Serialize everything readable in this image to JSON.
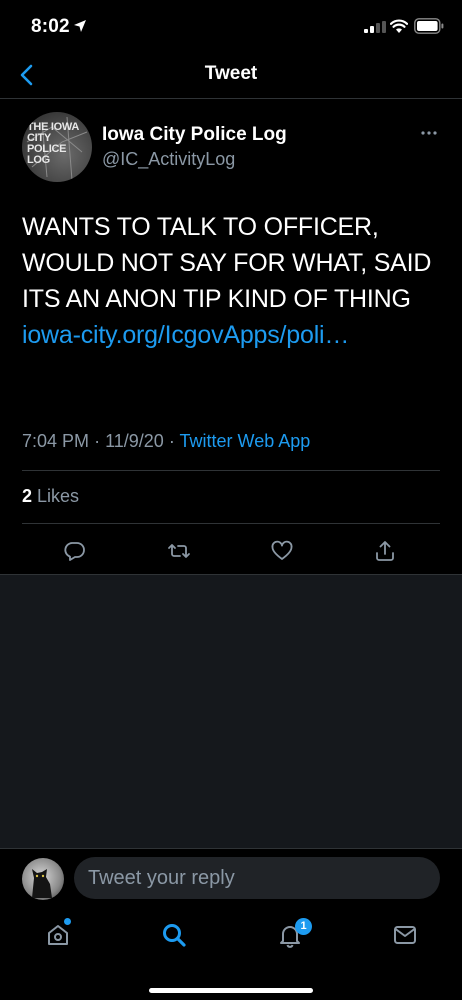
{
  "status_bar": {
    "time": "8:02"
  },
  "nav": {
    "title": "Tweet"
  },
  "tweet": {
    "avatar_text": "THE IOWA CITY POLICE LOG",
    "author_name": "Iowa City Police Log",
    "author_handle": "@IC_ActivityLog",
    "body": "WANTS TO TALK TO OFFICER, WOULD NOT SAY FOR WHAT, SAID ITS AN ANON TIP KIND OF THING",
    "link": "iowa-city.org/IcgovApps/poli…",
    "time": "7:04 PM",
    "date": "11/9/20",
    "separator": "·",
    "source": "Twitter Web App",
    "likes_count": "2",
    "likes_label": "Likes"
  },
  "reply": {
    "placeholder": "Tweet your reply"
  },
  "tabs": {
    "notifications_badge": "1"
  },
  "colors": {
    "accent": "#1d9bf0",
    "muted": "#8b98a5",
    "background": "#000000",
    "divider": "#2f3336"
  },
  "icons": [
    "back-chevron-icon",
    "more-icon",
    "reply-icon",
    "retweet-icon",
    "like-icon",
    "share-icon",
    "home-icon",
    "search-icon",
    "notifications-icon",
    "messages-icon"
  ]
}
